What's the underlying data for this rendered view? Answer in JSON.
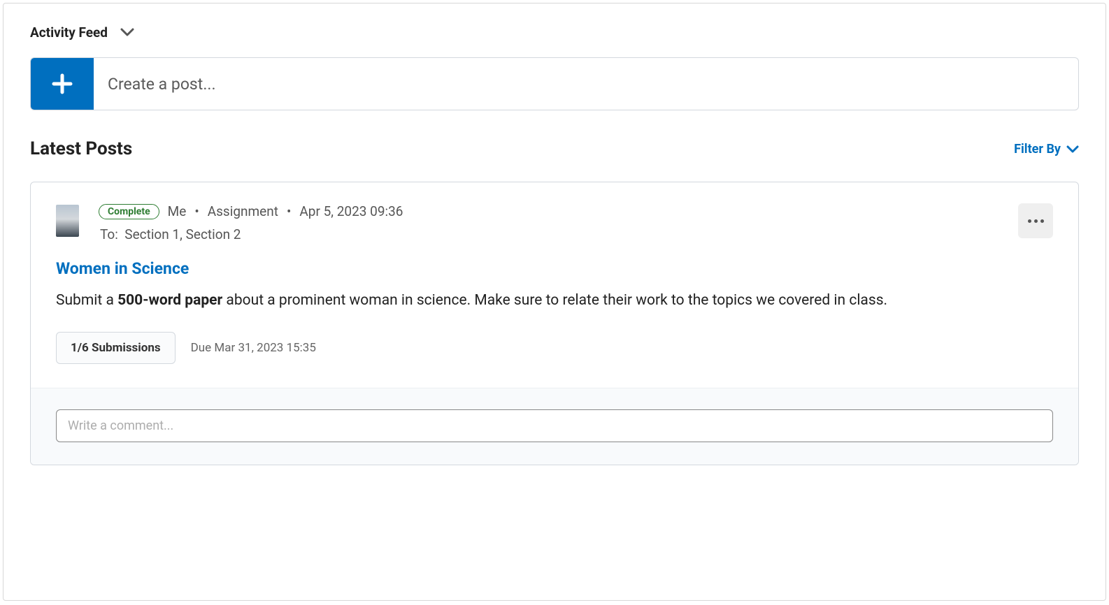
{
  "header": {
    "title": "Activity Feed"
  },
  "create_post": {
    "placeholder": "Create a post..."
  },
  "section": {
    "title": "Latest Posts",
    "filter_label": "Filter By"
  },
  "post": {
    "status": "Complete",
    "author": "Me",
    "type": "Assignment",
    "date": "Apr 5, 2023 09:36",
    "to_label": "To:",
    "recipients": "Section 1, Section 2",
    "title": "Women in Science",
    "desc_pre": "Submit a ",
    "desc_bold": "500-word paper",
    "desc_post": " about a prominent woman in science. Make sure to relate their work to the topics we covered in class.",
    "submissions": "1/6 Submissions",
    "due": "Due Mar 31, 2023 15:35"
  },
  "comment": {
    "placeholder": "Write a comment..."
  }
}
